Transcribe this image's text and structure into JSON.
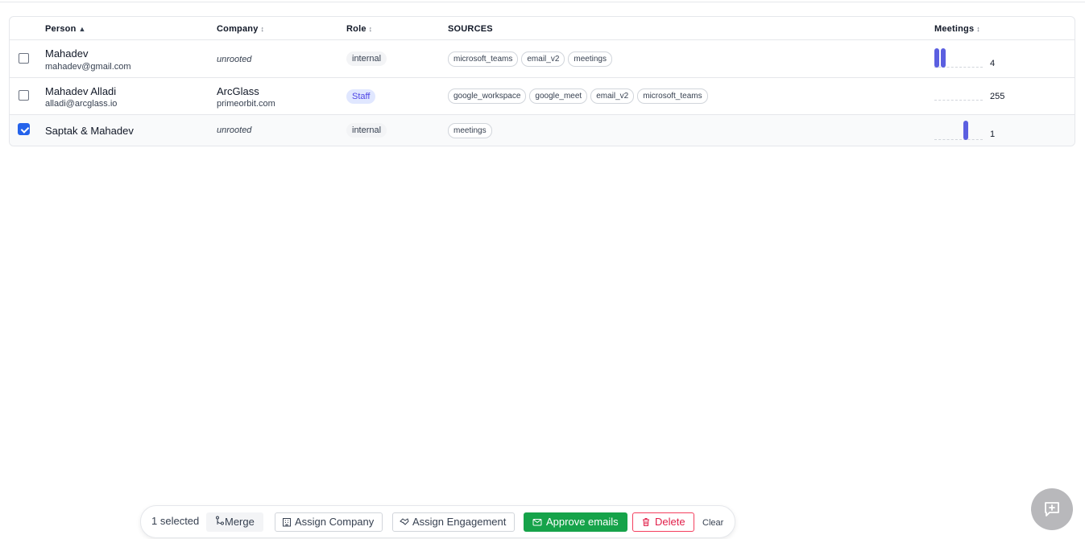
{
  "table": {
    "headers": {
      "person": "Person",
      "person_sort": "▲",
      "company": "Company",
      "role": "Role",
      "sources": "SOURCES",
      "meetings": "Meetings",
      "sort_glyph": "↕"
    },
    "rows": [
      {
        "checked": false,
        "name": "Mahadev",
        "email": "mahadev@gmail.com",
        "company": "unrooted",
        "company_domain": "",
        "role": "internal",
        "sources": [
          "microsoft_teams",
          "email_v2",
          "meetings"
        ],
        "meetings": "4"
      },
      {
        "checked": false,
        "name": "Mahadev Alladi",
        "email": "alladi@arcglass.io",
        "company": "ArcGlass",
        "company_domain": "primeorbit.com",
        "role": "Staff",
        "sources": [
          "google_workspace",
          "google_meet",
          "email_v2",
          "microsoft_teams"
        ],
        "meetings": "255"
      },
      {
        "checked": true,
        "name": "Saptak & Mahadev",
        "email": "",
        "company": "unrooted",
        "company_domain": "",
        "role": "internal",
        "sources": [
          "meetings"
        ],
        "meetings": "1"
      }
    ]
  },
  "actionbar": {
    "selected_text": "1 selected",
    "merge": "Merge",
    "assign_company": "Assign Company",
    "assign_engagement": "Assign Engagement",
    "approve_emails": "Approve emails",
    "delete": "Delete",
    "clear": "Clear"
  },
  "colors": {
    "accent": "#5b5fe0",
    "approve": "#16a34a",
    "delete": "#e11d48",
    "staff_badge": "#e0e7ff"
  },
  "icons": {
    "merge": "git-merge-icon",
    "assign_company": "building-icon",
    "assign_engagement": "handshake-icon",
    "approve": "mail-icon",
    "delete": "trash-icon",
    "fab": "message-plus-icon"
  }
}
